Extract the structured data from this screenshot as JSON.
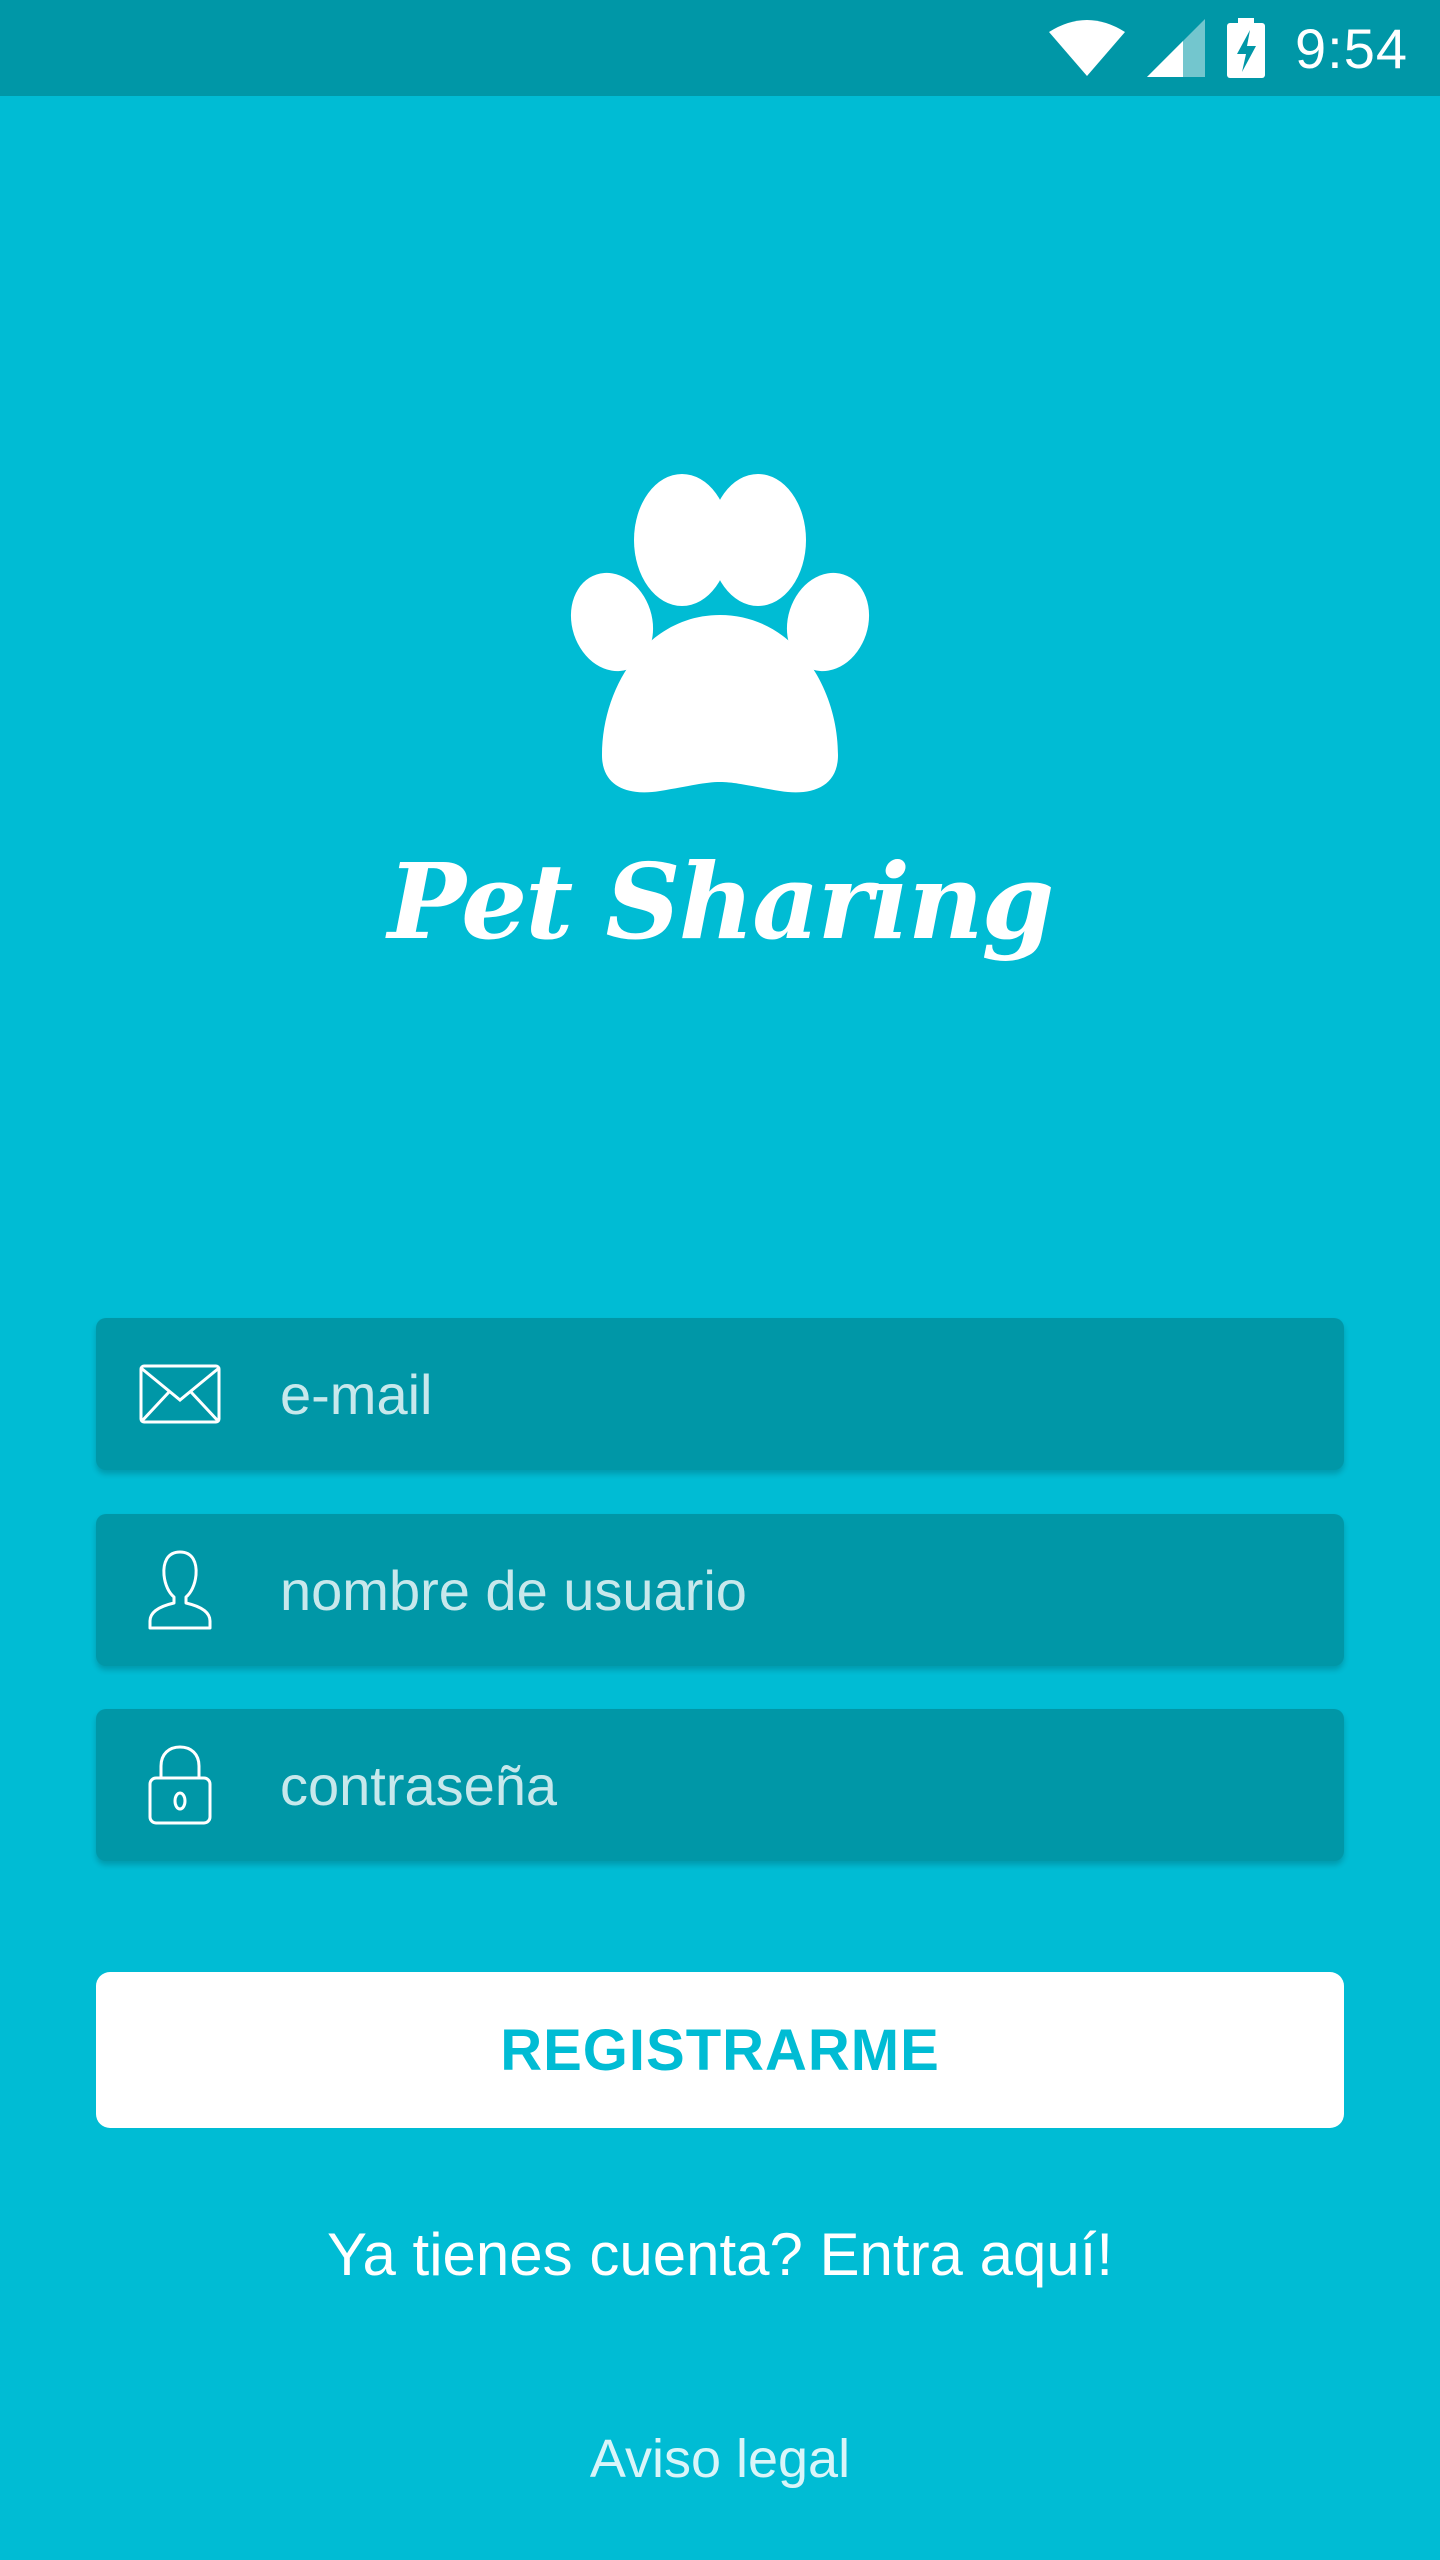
{
  "status_bar": {
    "time": "9:54",
    "icons": [
      "wifi-icon",
      "cell-signal-icon",
      "battery-charging-icon"
    ]
  },
  "app": {
    "name": "Pet Sharing",
    "logo_icon": "paw-icon"
  },
  "form": {
    "email": {
      "placeholder": "e-mail",
      "value": "",
      "icon": "envelope-icon"
    },
    "username": {
      "placeholder": "nombre de usuario",
      "value": "",
      "icon": "user-icon"
    },
    "password": {
      "placeholder": "contraseña",
      "value": "",
      "icon": "lock-icon"
    }
  },
  "actions": {
    "register_label": "REGISTRARME",
    "login_prompt": "Ya tienes cuenta? Entra aquí!",
    "legal_label": "Aviso legal"
  },
  "colors": {
    "background": "#00BCD4",
    "status_bar": "#0097A7",
    "field_background": "#0097A7",
    "button_background": "#FFFFFF",
    "button_text": "#00BCD4"
  }
}
